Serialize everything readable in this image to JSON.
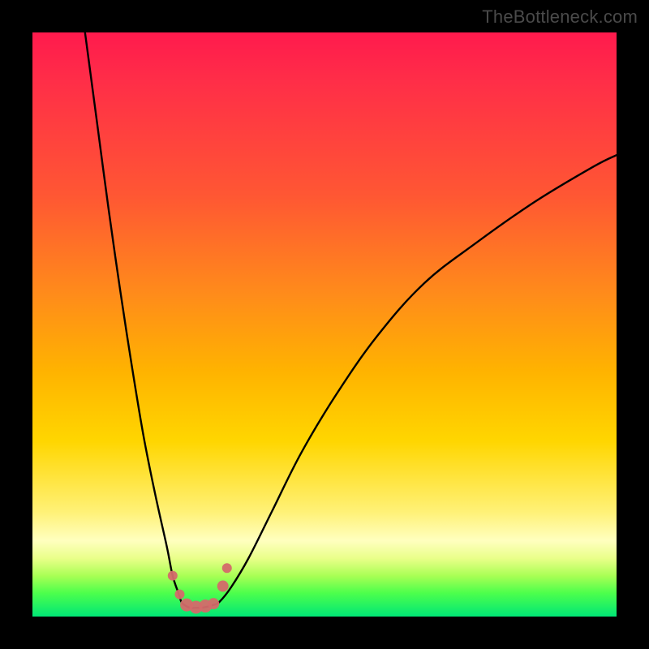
{
  "watermark": "TheBottleneck.com",
  "chart_data": {
    "type": "line",
    "title": "",
    "xlabel": "",
    "ylabel": "",
    "xlim": [
      0,
      100
    ],
    "ylim": [
      0,
      100
    ],
    "annotations": [],
    "series": [
      {
        "name": "left-descending-curve",
        "x": [
          9,
          11,
          13,
          15,
          17,
          19,
          21,
          23,
          24,
          25,
          25.5,
          26
        ],
        "y": [
          100,
          85,
          70,
          56,
          43,
          31,
          21,
          12,
          7,
          4,
          2.5,
          2
        ]
      },
      {
        "name": "trough-segment",
        "x": [
          26,
          27,
          28,
          29,
          30,
          31,
          32
        ],
        "y": [
          2,
          1.5,
          1.5,
          1.5,
          1.7,
          2.0,
          2.5
        ]
      },
      {
        "name": "right-ascending-curve",
        "x": [
          32,
          34,
          37,
          41,
          46,
          52,
          59,
          67,
          76,
          86,
          96,
          100
        ],
        "y": [
          2.5,
          5,
          10,
          18,
          28,
          38,
          48,
          57,
          64,
          71,
          77,
          79
        ]
      }
    ],
    "markers": {
      "name": "trough-points",
      "color": "#d46a6a",
      "points": [
        {
          "x": 24.0,
          "y": 7.0,
          "r": 6
        },
        {
          "x": 25.2,
          "y": 3.8,
          "r": 6
        },
        {
          "x": 26.4,
          "y": 2.0,
          "r": 8
        },
        {
          "x": 28.0,
          "y": 1.6,
          "r": 8
        },
        {
          "x": 29.6,
          "y": 1.8,
          "r": 8
        },
        {
          "x": 31.0,
          "y": 2.2,
          "r": 7
        },
        {
          "x": 32.6,
          "y": 5.2,
          "r": 7
        },
        {
          "x": 33.3,
          "y": 8.3,
          "r": 6
        }
      ]
    }
  }
}
